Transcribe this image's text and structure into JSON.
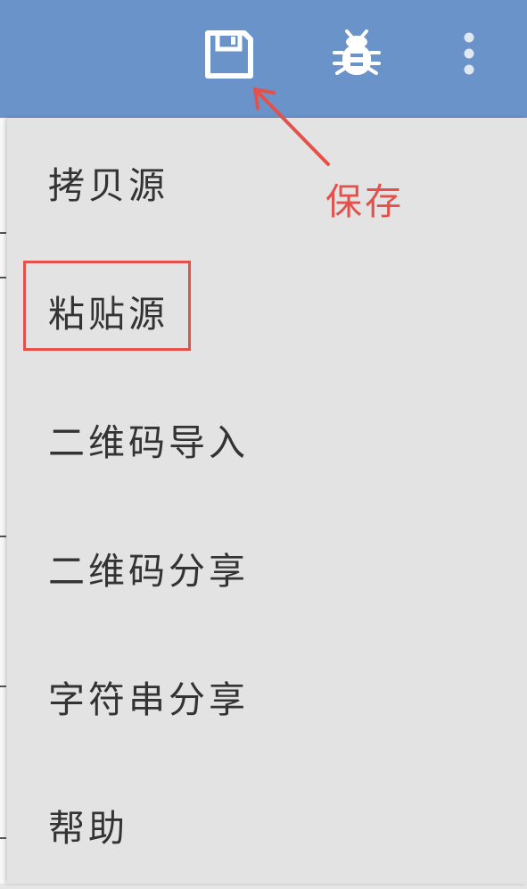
{
  "toolbar": {
    "bg_color": "#6a93c9",
    "actions": [
      {
        "icon": "save-icon"
      },
      {
        "icon": "bug-icon"
      },
      {
        "icon": "more-vertical-icon"
      }
    ]
  },
  "menu": {
    "items": [
      {
        "label": "拷贝源"
      },
      {
        "label": "粘贴源"
      },
      {
        "label": "二维码导入"
      },
      {
        "label": "二维码分享"
      },
      {
        "label": "字符串分享"
      },
      {
        "label": "帮助"
      }
    ],
    "highlighted_index": 1
  },
  "annotation": {
    "text": "保存",
    "color": "#e4514b"
  }
}
